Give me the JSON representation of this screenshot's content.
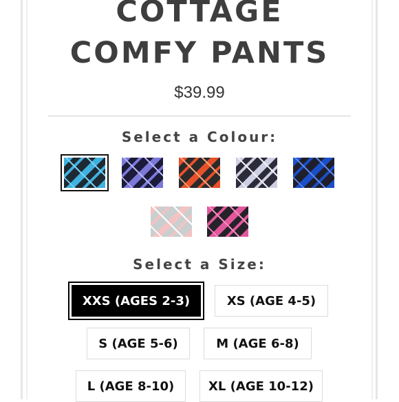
{
  "product": {
    "title_line1": "COTTAGE",
    "title_line2": "COMFY PANTS",
    "price": "$39.99"
  },
  "colour_section": {
    "label": "Select a Colour:",
    "swatches": [
      {
        "name": "teal-plaid",
        "base": "#1e2a33",
        "accent": "#3fb2e0",
        "stripe": "#7ad0f2",
        "selected": true
      },
      {
        "name": "purple-plaid",
        "base": "#1c1b3a",
        "accent": "#7b78d9",
        "stripe": "#b7b4f3",
        "selected": false
      },
      {
        "name": "orange-plaid",
        "base": "#2a2a2a",
        "accent": "#e8502a",
        "stripe": "#f3a27f",
        "selected": false
      },
      {
        "name": "grey-plaid",
        "base": "#2b2b3a",
        "accent": "#cfcfe3",
        "stripe": "#f0f0f7",
        "selected": false
      },
      {
        "name": "blue-plaid",
        "base": "#1f1f2b",
        "accent": "#1a4fc9",
        "stripe": "#5a86ec",
        "selected": false
      },
      {
        "name": "pink-grey-plaid",
        "base": "#c9cfcf",
        "accent": "#f3c3c3",
        "stripe": "#ffffff",
        "selected": false
      },
      {
        "name": "pink-black-plaid",
        "base": "#26222a",
        "accent": "#e2579b",
        "stripe": "#f48cc0",
        "selected": false
      }
    ]
  },
  "size_section": {
    "label": "Select a Size:",
    "sizes": [
      {
        "label": "XXS (AGES 2-3)",
        "selected": true
      },
      {
        "label": "XS (AGE 4-5)",
        "selected": false
      },
      {
        "label": "S (AGE 5-6)",
        "selected": false
      },
      {
        "label": "M (AGE 6-8)",
        "selected": false
      },
      {
        "label": "L (AGE 8-10)",
        "selected": false
      },
      {
        "label": "XL (AGE 10-12)",
        "selected": false
      }
    ]
  }
}
